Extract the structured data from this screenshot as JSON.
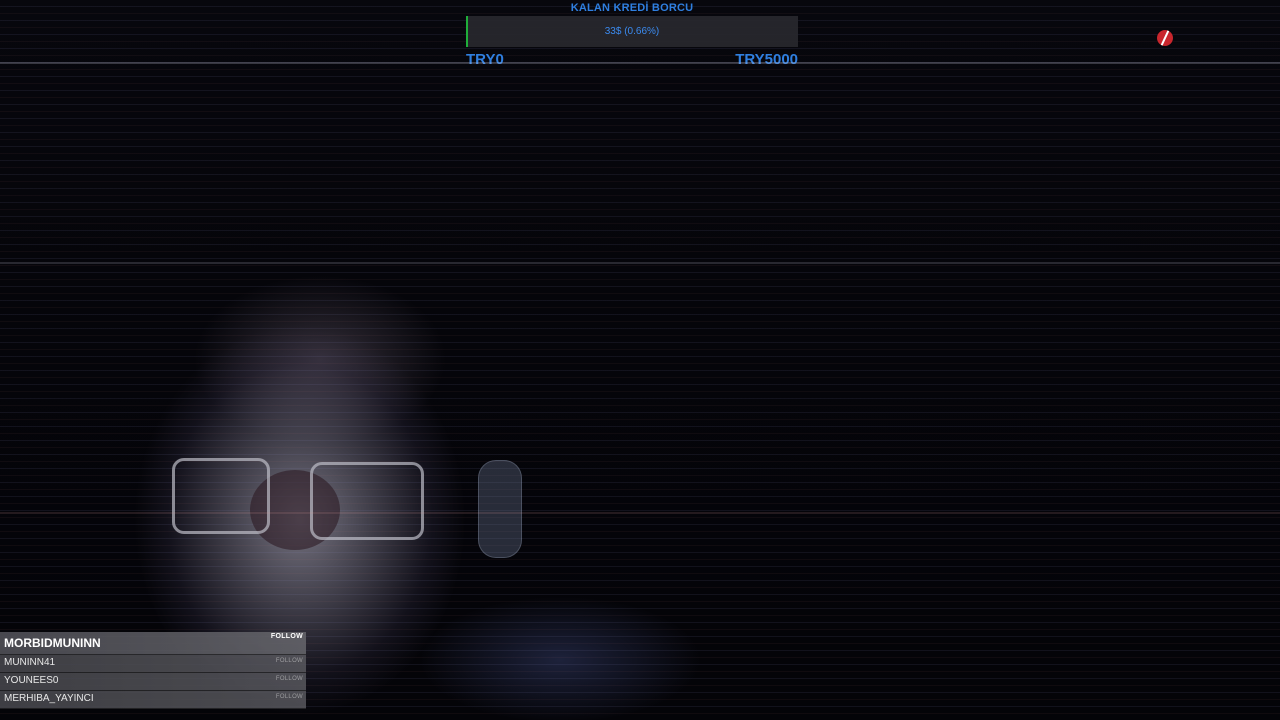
{
  "goal": {
    "title": "KALAN KREDİ BORCU",
    "amount_text": "33$ (0.66%)",
    "progress_percent": 0.66,
    "min_label": "TRY0",
    "max_label": "TRY5000",
    "accent_color": "#2f7fe0",
    "fill_color": "#1fae3a"
  },
  "logo": {
    "icon": "red-slash-logo-icon",
    "color": "#c8262d"
  },
  "follows": {
    "latest": {
      "name": "MORBIDMUNINN",
      "label": "FOLLOW"
    },
    "items": [
      {
        "name": "MUNINN41",
        "label": "FOLLOW"
      },
      {
        "name": "YOUNEES0",
        "label": "FOLLOW"
      },
      {
        "name": "MERHIBA_YAYINCI",
        "label": "FOLLOW"
      }
    ]
  }
}
